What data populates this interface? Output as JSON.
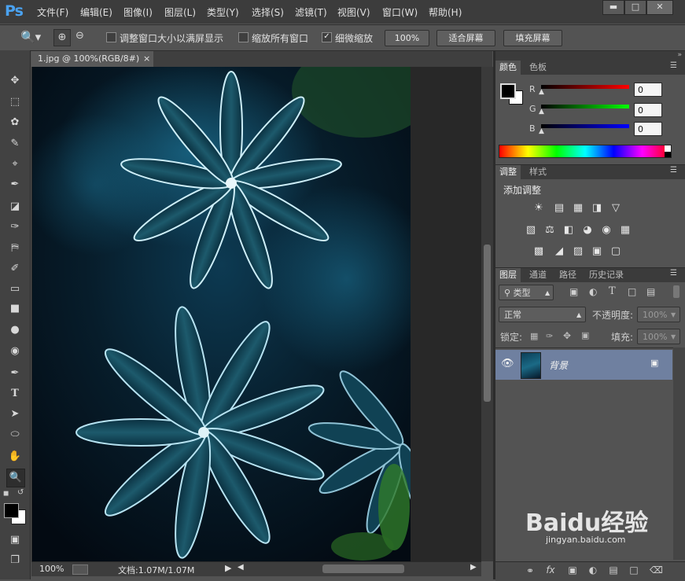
{
  "app": {
    "logo": "Ps"
  },
  "menu": [
    "文件(F)",
    "编辑(E)",
    "图像(I)",
    "图层(L)",
    "类型(Y)",
    "选择(S)",
    "滤镜(T)",
    "视图(V)",
    "窗口(W)",
    "帮助(H)"
  ],
  "window_controls": [
    "minimize-icon",
    "maximize-icon",
    "close-icon"
  ],
  "options": {
    "resize_windows_label": "调整窗口大小以满屏显示",
    "resize_windows_checked": false,
    "zoom_all_label": "缩放所有窗口",
    "zoom_all_checked": false,
    "scrubby_label": "细微缩放",
    "scrubby_checked": true,
    "btn_100": "100%",
    "btn_fit": "适合屏幕",
    "btn_fill": "填充屏幕"
  },
  "tools": [
    "move-icon",
    "marquee-icon",
    "lasso-icon",
    "quick-select-icon",
    "crop-icon",
    "eyedropper-icon",
    "healing-icon",
    "brush-icon",
    "stamp-icon",
    "history-brush-icon",
    "eraser-icon",
    "gradient-icon",
    "blur-icon",
    "dodge-icon",
    "pen-icon",
    "type-icon",
    "path-select-icon",
    "ellipse-icon",
    "hand-icon",
    "zoom-icon"
  ],
  "document": {
    "tab_title": "1.jpg @ 100%(RGB/8#)",
    "status_zoom": "100%",
    "status_doc": "文档:1.07M/1.07M"
  },
  "color_panel": {
    "tabs": [
      "颜色",
      "色板"
    ],
    "r_label": "R",
    "g_label": "G",
    "b_label": "B",
    "r": "0",
    "g": "0",
    "b": "0",
    "foreground": "#000000",
    "background": "#ffffff"
  },
  "adjust_panel": {
    "tabs": [
      "调整",
      "样式"
    ],
    "title": "添加调整"
  },
  "layers_panel": {
    "tabs": [
      "图层",
      "通道",
      "路径",
      "历史记录"
    ],
    "filter_label": "类型",
    "blend_mode": "正常",
    "opacity_label": "不透明度:",
    "opacity_value": "100%",
    "lock_label": "锁定:",
    "fill_label": "填充:",
    "fill_value": "100%",
    "layers": [
      {
        "name": "背景",
        "visible": true,
        "locked": true
      }
    ]
  },
  "watermark": {
    "text": "Baidu经验",
    "sub": "jingyan.baidu.com"
  }
}
